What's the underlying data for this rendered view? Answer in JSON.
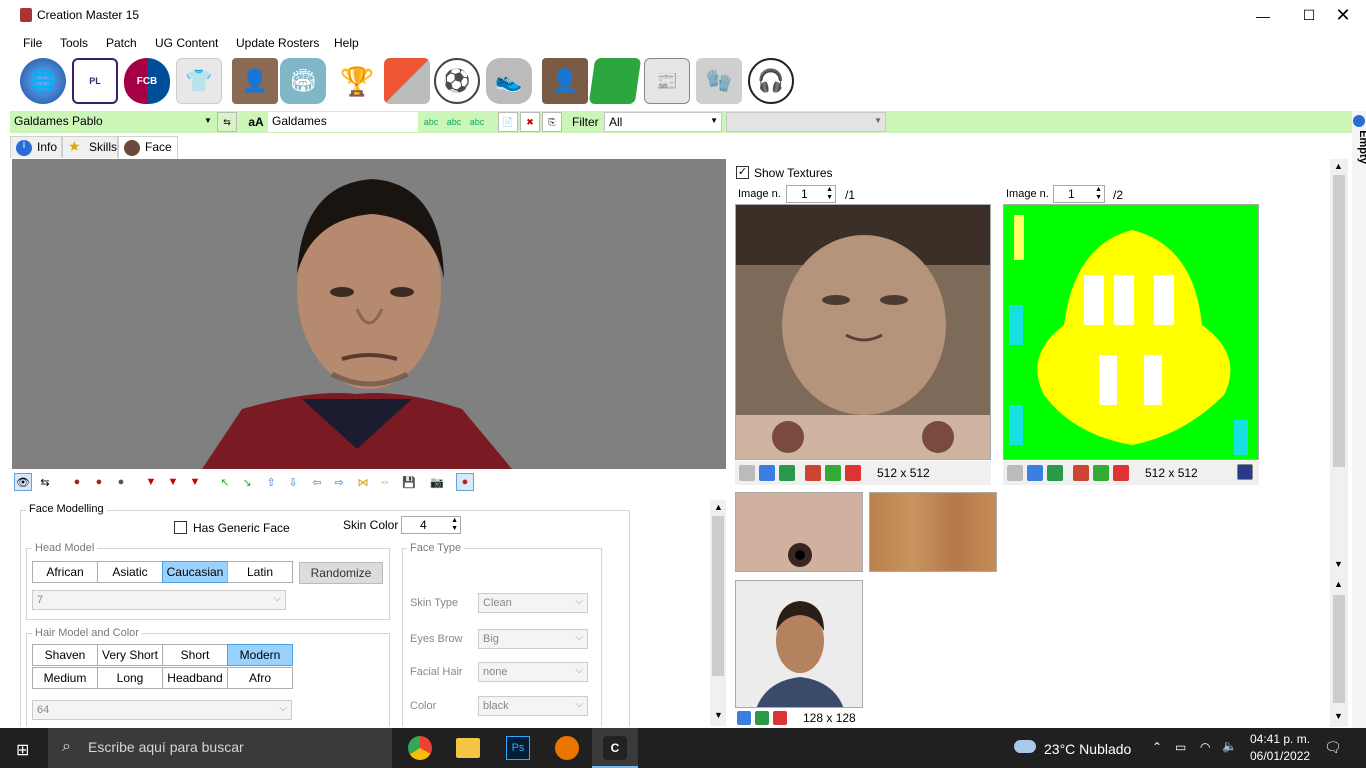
{
  "window": {
    "title": "Creation Master 15",
    "minimize_icon": "minimize-icon",
    "maximize_icon": "maximize-icon",
    "close_icon": "close-icon"
  },
  "menu": [
    "File",
    "Tools",
    "Patch",
    "UG Content",
    "Update Rosters",
    "Help"
  ],
  "toolbar_icons": [
    "world-icon",
    "premier-league-icon",
    "fcb-crest-icon",
    "jersey-icon",
    "player-icon",
    "stadium-icon",
    "world-cup-trophy-icon",
    "cards-icon",
    "ball-icon",
    "boots-icon",
    "manager-icon",
    "pitch-icon",
    "newspaper-icon",
    "gloves-icon",
    "headphones-icon"
  ],
  "playerbar": {
    "player_name": "Galdames Pablo",
    "short_name": "Galdames",
    "font_case_label": "aA",
    "filter_label": "Filter",
    "filter_value": "All",
    "abc_label": "abc"
  },
  "tabs": [
    {
      "label": "Info",
      "icon": "info-icon"
    },
    {
      "label": "Skills",
      "icon": "star-icon"
    },
    {
      "label": "Face",
      "icon": "face-icon"
    }
  ],
  "face_modelling": {
    "title": "Face Modelling",
    "has_generic_face": "Has Generic Face",
    "has_generic_face_checked": false,
    "skin_color_label": "Skin Color",
    "skin_color_value": "4",
    "head_model": {
      "title": "Head Model",
      "options": [
        "African",
        "Asiatic",
        "Caucasian",
        "Latin"
      ],
      "selected": "Caucasian",
      "randomize": "Randomize",
      "model_value": "7"
    },
    "hair_model": {
      "title": "Hair Model and Color",
      "options": [
        "Shaven",
        "Very Short",
        "Short",
        "Modern",
        "Medium",
        "Long",
        "Headband",
        "Afro"
      ],
      "selected": "Modern",
      "model_value": "64"
    },
    "face_type": {
      "title": "Face Type",
      "fields": [
        {
          "label": "Skin Type",
          "value": "Clean"
        },
        {
          "label": "Eyes Brow",
          "value": "Big"
        },
        {
          "label": "Facial Hair",
          "value": "none"
        },
        {
          "label": "Color",
          "value": "black"
        }
      ]
    }
  },
  "textures": {
    "show_textures_label": "Show Textures",
    "show_textures_checked": true,
    "image_label": "Image n.",
    "face": {
      "image_n": "1",
      "total": "/1",
      "size": "512 x 512"
    },
    "mask": {
      "image_n": "1",
      "total": "/2",
      "size": "512 x 512"
    },
    "photo_size": "128 x 128"
  },
  "side_tab": "Empty",
  "taskbar": {
    "search_placeholder": "Escribe aquí para buscar",
    "weather": "23°C  Nublado",
    "time": "04:41 p. m.",
    "date": "06/01/2022"
  },
  "colors": {
    "accent_selected": "#99d1ff",
    "playerbar_bg": "#ccf5b8",
    "mask_green": "#00ff00",
    "mask_yellow": "#ffff00"
  }
}
